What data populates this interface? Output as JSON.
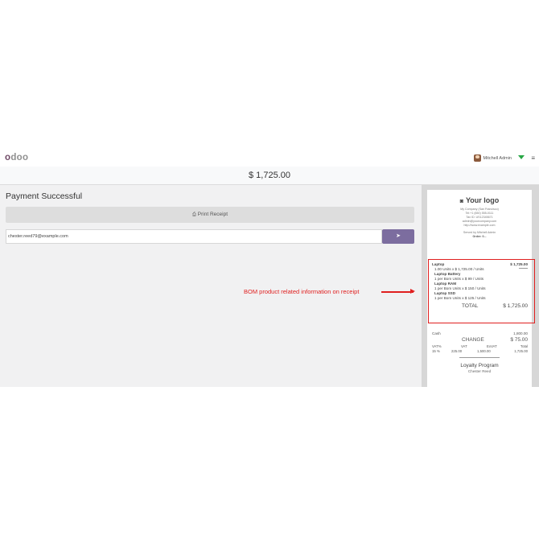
{
  "navbar": {
    "logo_first": "o",
    "logo_rest": "doo",
    "user_name": "Mitchell Admin",
    "menu_icon": "hamburger-icon",
    "status_color": "#28a745"
  },
  "amount": "$ 1,725.00",
  "left": {
    "title": "Payment Successful",
    "print_label": "Print Receipt",
    "email_value": "chester.reed79@example.com",
    "annotation": "BOM product related information on receipt"
  },
  "receipt": {
    "logo_text": "Your logo",
    "company": [
      "My Company (San Francisco)",
      "Tel:+1 (650) 555-0111",
      "Tax ID: US12345671",
      "admin@yourcompany.com",
      "http://www.example.com"
    ],
    "served_by": "Served by Mitchell Admin",
    "order": "Order: 0...",
    "lines": [
      {
        "text": "Laptop",
        "amount": "$ 1,725.00",
        "style": "b"
      },
      {
        "text": "1.00  Units x $ 1,725.00 / Units",
        "amount": "",
        "style": "ind"
      },
      {
        "text": "Laptop Battery",
        "amount": "",
        "style": "ind b"
      },
      {
        "text": "1 per Bom Units x $ 99 / Units",
        "amount": "",
        "style": "ind"
      },
      {
        "text": "Laptop RAM",
        "amount": "",
        "style": "ind b"
      },
      {
        "text": "1 per Bom Units x $ 150 / Units",
        "amount": "",
        "style": "ind"
      },
      {
        "text": "Laptop SSD",
        "amount": "",
        "style": "ind b"
      },
      {
        "text": "1 per Bom Units x $ 125 / Units",
        "amount": "",
        "style": "ind"
      }
    ],
    "total_label": "TOTAL",
    "total_amount": "$ 1,725.00",
    "payment_method": "Cash",
    "payment_amount": "1,800.00",
    "change_label": "CHANGE",
    "change_amount": "$ 75.00",
    "vat_headers": [
      "VAT%",
      "VAT",
      "ExVAT",
      "Total"
    ],
    "vat_values": [
      "15 %",
      "225.00",
      "1,500.00",
      "1,725.00"
    ],
    "loyalty_title": "Loyalty Program",
    "customer": "Chester Reed"
  }
}
